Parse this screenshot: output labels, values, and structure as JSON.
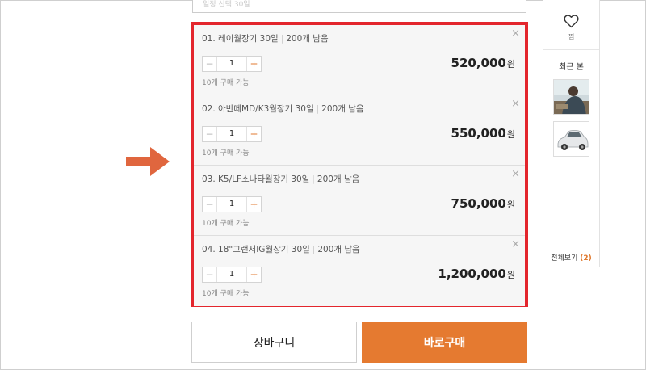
{
  "top_field": {
    "hint": "일정 선택 30일"
  },
  "options": [
    {
      "name": "01. 레이월장기 30일",
      "stock": "200개 남음",
      "qty": "1",
      "limit": "10개 구매 가능",
      "price": "520,000",
      "currency": "원"
    },
    {
      "name": "02. 아반떼MD/K3월장기 30일",
      "stock": "200개 남음",
      "qty": "1",
      "limit": "10개 구매 가능",
      "price": "550,000",
      "currency": "원"
    },
    {
      "name": "03. K5/LF소나타월장기 30일",
      "stock": "200개 남음",
      "qty": "1",
      "limit": "10개 구매 가능",
      "price": "750,000",
      "currency": "원"
    },
    {
      "name": "04. 18\"그랜저IG월장기 30일",
      "stock": "200개 남음",
      "qty": "1",
      "limit": "10개 구매 가능",
      "price": "1,200,000",
      "currency": "원"
    }
  ],
  "controls": {
    "minus": "−",
    "plus": "+",
    "close": "×"
  },
  "buttons": {
    "cart": "장바구니",
    "buy": "바로구매"
  },
  "sidebar": {
    "wish_label": "찜",
    "recent_title": "최근 본",
    "view_all_label": "전체보기",
    "view_all_count": "(2)"
  },
  "colors": {
    "highlight": "#e3262d",
    "accent": "#e57a30",
    "arrow": "#e0663e"
  },
  "icons": {
    "arrow": "right-arrow-icon",
    "wish": "heart-icon",
    "close": "close-icon"
  }
}
